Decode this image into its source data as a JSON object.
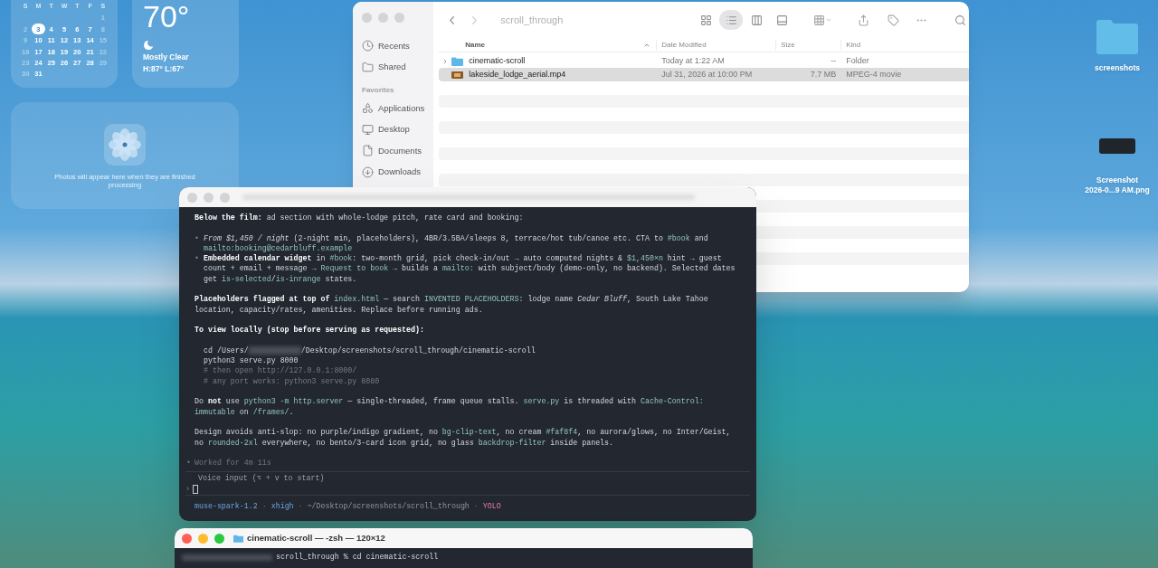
{
  "calendar": {
    "weekdays": [
      "S",
      "M",
      "T",
      "W",
      "T",
      "F",
      "S"
    ],
    "weeks": [
      [
        {
          "day": "1",
          "dim": true,
          "selected": false
        }
      ],
      [
        {
          "day": "2",
          "dim": true,
          "selected": false
        },
        {
          "day": "3",
          "dim": false,
          "selected": true
        },
        {
          "day": "4",
          "dim": false,
          "selected": false
        },
        {
          "day": "5",
          "dim": false,
          "selected": false
        },
        {
          "day": "6",
          "dim": false,
          "selected": false
        },
        {
          "day": "7",
          "dim": false,
          "selected": false
        },
        {
          "day": "8",
          "dim": true,
          "selected": false
        }
      ],
      [
        {
          "day": "9",
          "dim": true,
          "selected": false
        },
        {
          "day": "10",
          "dim": false,
          "selected": false
        },
        {
          "day": "11",
          "dim": false,
          "selected": false
        },
        {
          "day": "12",
          "dim": false,
          "selected": false
        },
        {
          "day": "13",
          "dim": false,
          "selected": false
        },
        {
          "day": "14",
          "dim": false,
          "selected": false
        },
        {
          "day": "15",
          "dim": true,
          "selected": false
        }
      ],
      [
        {
          "day": "16",
          "dim": true,
          "selected": false
        },
        {
          "day": "17",
          "dim": false,
          "selected": false
        },
        {
          "day": "18",
          "dim": false,
          "selected": false
        },
        {
          "day": "19",
          "dim": false,
          "selected": false
        },
        {
          "day": "20",
          "dim": false,
          "selected": false
        },
        {
          "day": "21",
          "dim": false,
          "selected": false
        },
        {
          "day": "22",
          "dim": true,
          "selected": false
        }
      ],
      [
        {
          "day": "23",
          "dim": true,
          "selected": false
        },
        {
          "day": "24",
          "dim": false,
          "selected": false
        },
        {
          "day": "25",
          "dim": false,
          "selected": false
        },
        {
          "day": "26",
          "dim": false,
          "selected": false
        },
        {
          "day": "27",
          "dim": false,
          "selected": false
        },
        {
          "day": "28",
          "dim": false,
          "selected": false
        },
        {
          "day": "29",
          "dim": true,
          "selected": false
        }
      ],
      [
        {
          "day": "30",
          "dim": true,
          "selected": false
        },
        {
          "day": "31",
          "dim": false,
          "selected": false
        }
      ]
    ]
  },
  "weather": {
    "temperature": "70°",
    "condition": "Mostly Clear",
    "range": "H:87° L:67°"
  },
  "photos_widget": {
    "message": "Photos will appear here when they are finished processing"
  },
  "finder": {
    "title": "scroll_through",
    "nav": [
      {
        "kind": "back",
        "disabled": false
      },
      {
        "kind": "forward",
        "disabled": true
      }
    ],
    "views": [
      {
        "kind": "icons",
        "selected": false
      },
      {
        "kind": "list",
        "selected": true
      },
      {
        "kind": "columns",
        "selected": false
      },
      {
        "kind": "gallery",
        "selected": false
      }
    ],
    "sidebar": [
      {
        "kind": "recents",
        "label": "Recents"
      },
      {
        "kind": "shared",
        "label": "Shared"
      },
      {
        "kind": "header",
        "label": "Favorites"
      },
      {
        "kind": "applications",
        "label": "Applications"
      },
      {
        "kind": "desktop",
        "label": "Desktop"
      },
      {
        "kind": "documents",
        "label": "Documents"
      },
      {
        "kind": "downloads",
        "label": "Downloads"
      }
    ],
    "columns": [
      "Name",
      "Date Modified",
      "Size",
      "Kind"
    ],
    "rows": [
      {
        "kind": "folder",
        "expanded": false,
        "selected": false,
        "name": "cinematic-scroll",
        "date": "Today at 1:22 AM",
        "size": "--",
        "type": "Folder"
      },
      {
        "kind": "movie",
        "selected": true,
        "name": "lakeside_lodge_aerial.mp4",
        "date": "Jul 31, 2026 at 10:00 PM",
        "size": "7.7 MB",
        "type": "MPEG-4 movie"
      }
    ]
  },
  "desktop_icons": [
    {
      "kind": "folder",
      "label": [
        "screenshots"
      ]
    },
    {
      "kind": "image",
      "label": [
        "Screenshot",
        "2026-0...9 AM.png"
      ]
    }
  ],
  "terminal": {
    "blocks": [
      [
        {
          "kind": "text",
          "segments": [
            {
              "kind": "bold",
              "text": "Below the film:"
            },
            {
              "kind": "text",
              "text": " ad section with whole-lodge pitch, rate card and booking:"
            }
          ]
        }
      ],
      [
        {
          "kind": "bullet",
          "marker": "•",
          "segments": [
            {
              "kind": "italic",
              "text": "From $1,450 / night"
            },
            {
              "kind": "text",
              "text": " (2-night min, placeholders), 4BR/3.5BA/sleeps 8, terrace/hot tub/canoe etc. CTA to "
            },
            {
              "kind": "code",
              "text": "#book"
            },
            {
              "kind": "text",
              "text": " and "
            },
            {
              "kind": "code",
              "text": "mailto:booking@cedarbluff.example"
            }
          ]
        },
        {
          "kind": "bullet",
          "marker": "•",
          "segments": [
            {
              "kind": "bold",
              "text": "Embedded calendar widget"
            },
            {
              "kind": "text",
              "text": " in "
            },
            {
              "kind": "code",
              "text": "#book"
            },
            {
              "kind": "text",
              "text": ": two-month grid, pick check-in/out → auto computed nights & "
            },
            {
              "kind": "code",
              "text": "$1,450×n"
            },
            {
              "kind": "text",
              "text": " hint → guest count + email + message → "
            },
            {
              "kind": "code",
              "text": "Request to book"
            },
            {
              "kind": "text",
              "text": " → builds a "
            },
            {
              "kind": "code",
              "text": "mailto:"
            },
            {
              "kind": "text",
              "text": " with subject/body (demo-only, no backend). Selected dates get "
            },
            {
              "kind": "code",
              "text": "is-selected"
            },
            {
              "kind": "text",
              "text": "/"
            },
            {
              "kind": "code",
              "text": "is-inrange"
            },
            {
              "kind": "text",
              "text": " states."
            }
          ]
        }
      ],
      [
        {
          "kind": "text",
          "segments": [
            {
              "kind": "bold",
              "text": "Placeholders flagged at top of "
            },
            {
              "kind": "code",
              "text": "index.html"
            },
            {
              "kind": "text",
              "text": " — search "
            },
            {
              "kind": "code",
              "text": "INVENTED PLACEHOLDERS"
            },
            {
              "kind": "text",
              "text": ": lodge name "
            },
            {
              "kind": "italic",
              "text": "Cedar Bluff"
            },
            {
              "kind": "text",
              "text": ", South Lake Tahoe location, capacity/rates, amenities. Replace before running ads."
            }
          ]
        }
      ],
      [
        {
          "kind": "text",
          "segments": [
            {
              "kind": "bold",
              "text": "To view locally (stop before serving as requested):"
            }
          ]
        }
      ],
      [
        {
          "kind": "code",
          "segments": [
            {
              "kind": "text",
              "text": "cd /Users/"
            },
            {
              "kind": "redacted"
            },
            {
              "kind": "text",
              "text": "/Desktop/screenshots/scroll_through/cinematic-scroll"
            }
          ]
        },
        {
          "kind": "code",
          "segments": [
            {
              "kind": "text",
              "text": "python3 serve.py 8000"
            }
          ]
        },
        {
          "kind": "comment",
          "segments": [
            {
              "kind": "text",
              "text": "# then open http://127.0.0.1:8000/"
            }
          ]
        },
        {
          "kind": "comment",
          "segments": [
            {
              "kind": "text",
              "text": "# any port works: python3 serve.py 8080"
            }
          ]
        }
      ],
      [
        {
          "kind": "text",
          "segments": [
            {
              "kind": "text",
              "text": "Do "
            },
            {
              "kind": "bold",
              "text": "not"
            },
            {
              "kind": "text",
              "text": " use "
            },
            {
              "kind": "code",
              "text": "python3 -m http.server"
            },
            {
              "kind": "text",
              "text": " — single-threaded, frame queue stalls. "
            },
            {
              "kind": "code",
              "text": "serve.py"
            },
            {
              "kind": "text",
              "text": " is threaded with "
            },
            {
              "kind": "code",
              "text": "Cache-Control: immutable"
            },
            {
              "kind": "text",
              "text": " on "
            },
            {
              "kind": "code",
              "text": "/frames/"
            },
            {
              "kind": "text",
              "text": "."
            }
          ]
        }
      ],
      [
        {
          "kind": "text",
          "segments": [
            {
              "kind": "text",
              "text": "Design avoids anti-slop: no purple/indigo gradient, no "
            },
            {
              "kind": "code",
              "text": "bg-clip-text"
            },
            {
              "kind": "text",
              "text": ", no cream "
            },
            {
              "kind": "code",
              "text": "#faf8f4"
            },
            {
              "kind": "text",
              "text": ", no aurora/glows, no Inter/Geist, no "
            },
            {
              "kind": "code",
              "text": "rounded-2xl"
            },
            {
              "kind": "text",
              "text": " everywhere, no bento/3-card icon grid, no glass "
            },
            {
              "kind": "code",
              "text": "backdrop-filter"
            },
            {
              "kind": "text",
              "text": " inside panels."
            }
          ]
        }
      ]
    ],
    "worked": {
      "marker": "•",
      "text": "Worked for 4m 11s"
    },
    "input": {
      "placeholder": "Voice input (⌥ + v to start)",
      "prompt": "›"
    },
    "status_bar": {
      "separator": "·",
      "items": [
        {
          "kind": "model",
          "text": "muse-spark-1.2"
        },
        {
          "kind": "effort",
          "text": "xhigh"
        },
        {
          "kind": "path",
          "text": "~/Desktop/screenshots/scroll_through"
        },
        {
          "kind": "mode",
          "text": "YOLO"
        }
      ]
    }
  },
  "terminal_2": {
    "title": "cinematic-scroll — -zsh — 120×12",
    "line": "scroll_through % cd cinematic-scroll"
  }
}
